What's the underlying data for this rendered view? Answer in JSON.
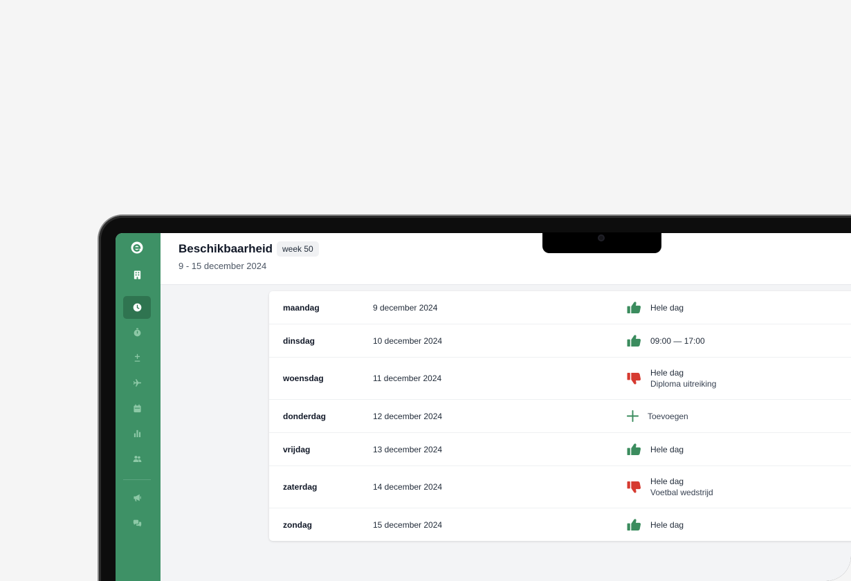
{
  "header": {
    "title": "Beschikbaarheid",
    "week_badge": "week 50",
    "subtitle": "9 - 15 december 2024"
  },
  "sidebar": {
    "items": [
      {
        "icon": "logo-icon"
      },
      {
        "icon": "building-icon"
      },
      {
        "icon": "clock-icon",
        "active": true
      },
      {
        "icon": "stopwatch-icon"
      },
      {
        "icon": "plus-minus-icon"
      },
      {
        "icon": "airplane-icon"
      },
      {
        "icon": "calendar-icon"
      },
      {
        "icon": "bar-chart-icon"
      },
      {
        "icon": "users-icon"
      },
      {
        "icon": "megaphone-icon"
      },
      {
        "icon": "chat-icon"
      }
    ]
  },
  "colors": {
    "sidebar": "#3e9166",
    "sidebar_active": "#2f7450",
    "available": "#3b8c5e",
    "unavailable": "#d63a30"
  },
  "days": [
    {
      "day": "maandag",
      "date": "9 december 2024",
      "status": "available",
      "text": "Hele dag"
    },
    {
      "day": "dinsdag",
      "date": "10 december 2024",
      "status": "available",
      "text": "09:00 — 17:00"
    },
    {
      "day": "woensdag",
      "date": "11 december 2024",
      "status": "unavailable",
      "text": "Hele dag",
      "note": "Diploma uitreiking"
    },
    {
      "day": "donderdag",
      "date": "12 december 2024",
      "status": "add",
      "text": "Toevoegen"
    },
    {
      "day": "vrijdag",
      "date": "13 december 2024",
      "status": "available",
      "text": "Hele dag"
    },
    {
      "day": "zaterdag",
      "date": "14 december 2024",
      "status": "unavailable",
      "text": "Hele dag",
      "note": "Voetbal wedstrijd"
    },
    {
      "day": "zondag",
      "date": "15 december 2024",
      "status": "available",
      "text": "Hele dag"
    }
  ]
}
